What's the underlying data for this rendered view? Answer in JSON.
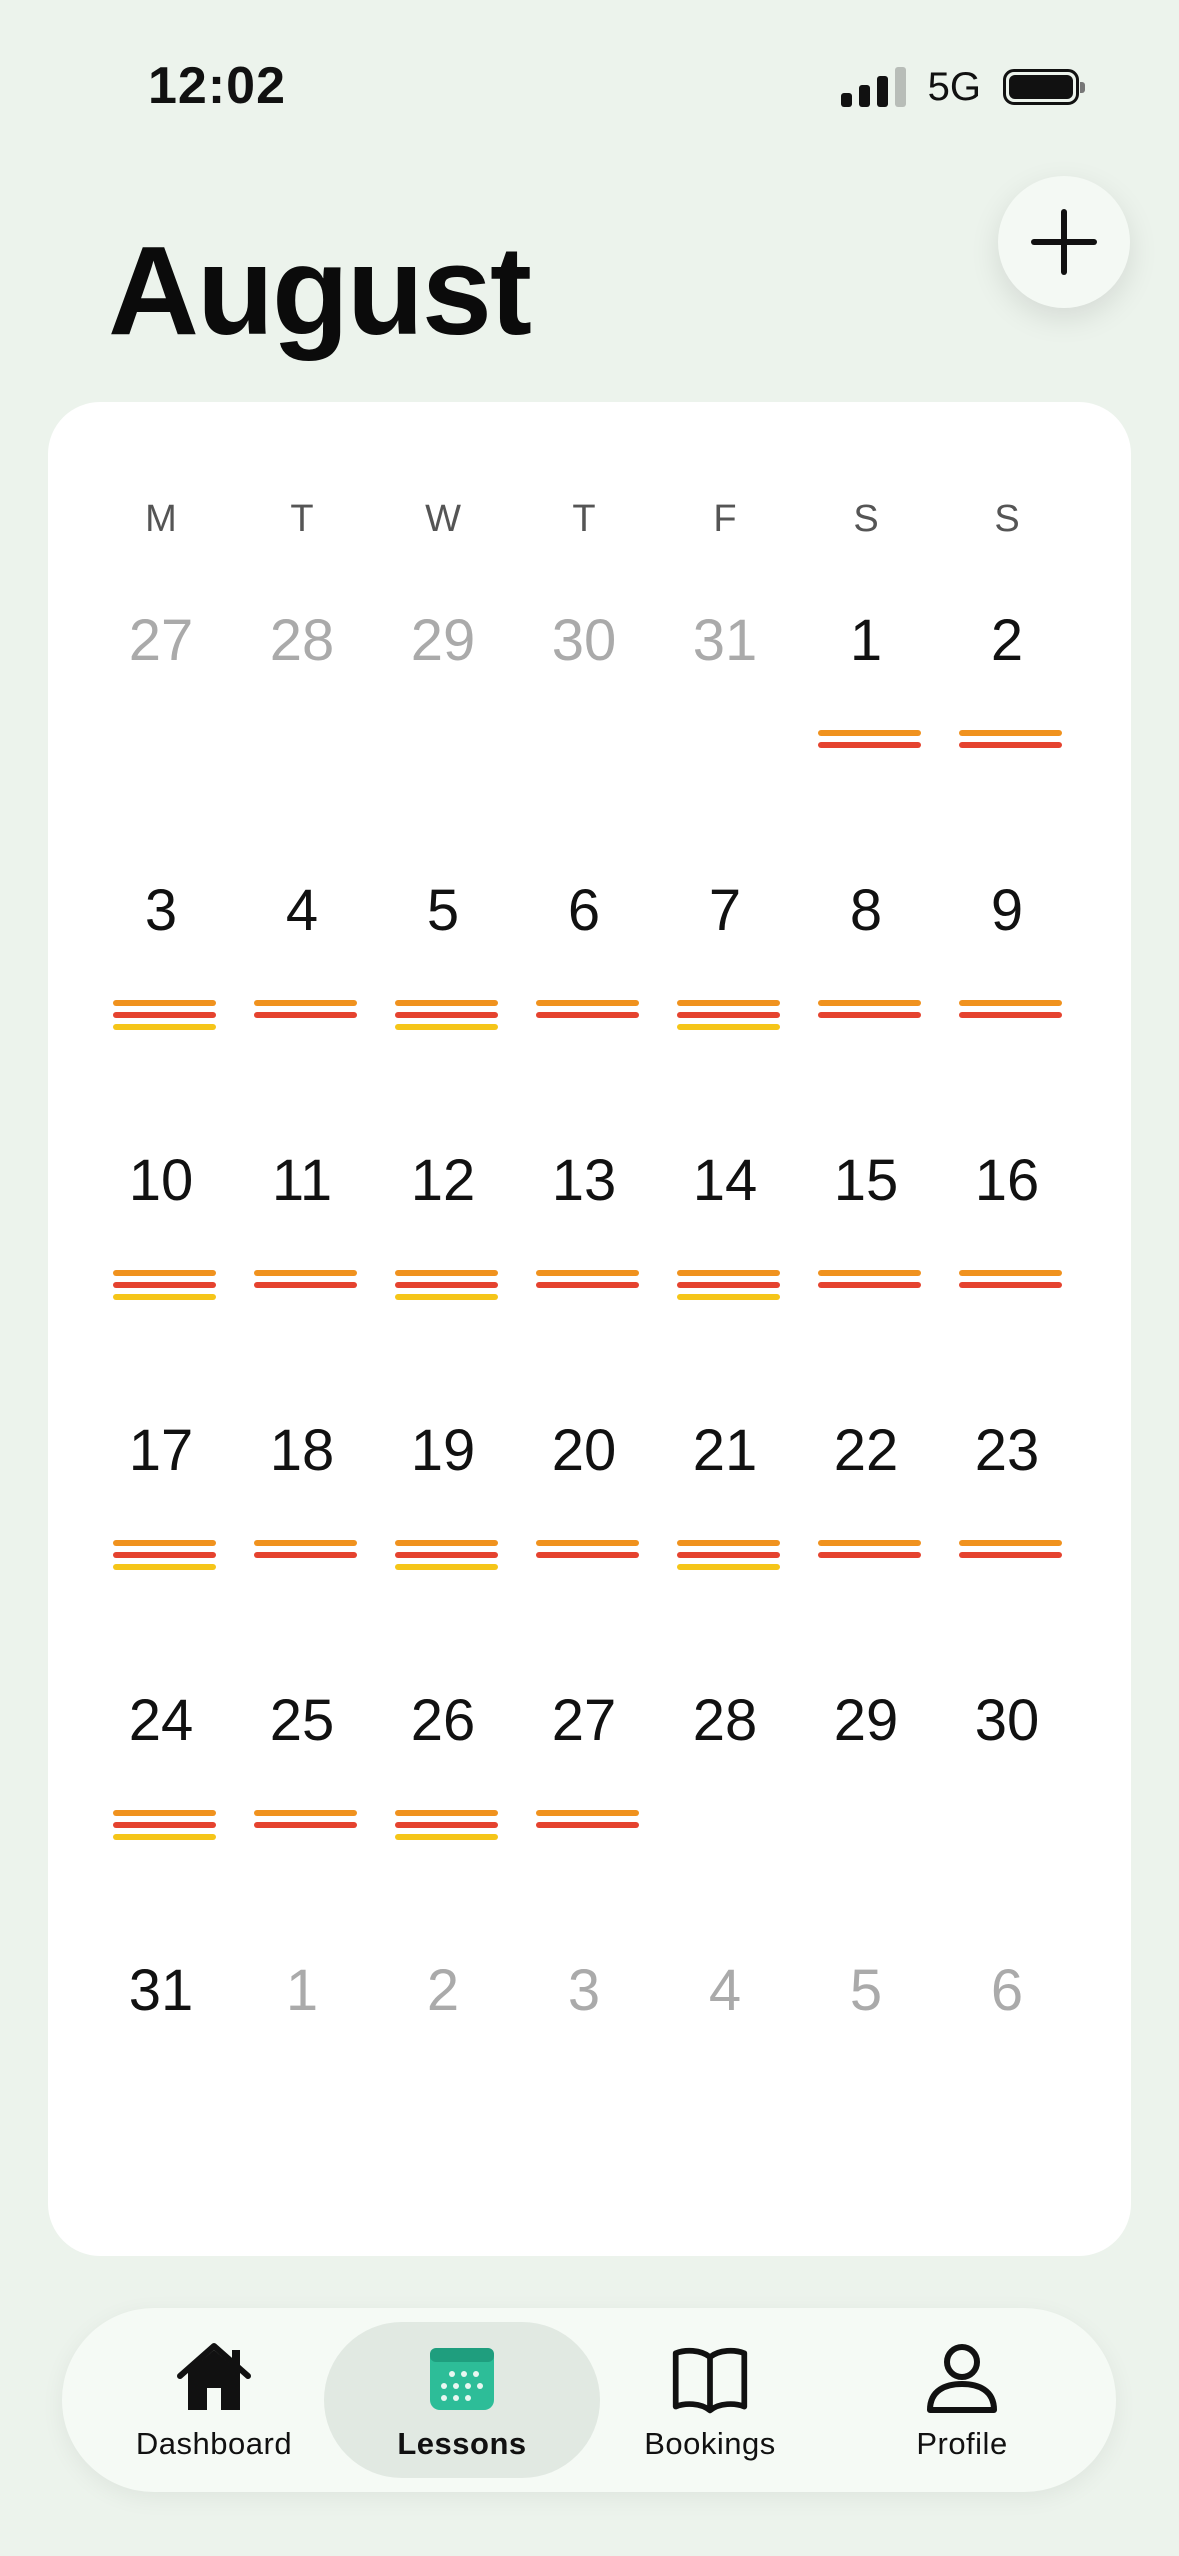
{
  "status": {
    "time": "12:02",
    "network": "5G"
  },
  "header": {
    "title": "August",
    "add_icon": "plus-icon"
  },
  "calendar": {
    "weekdays": [
      "M",
      "T",
      "W",
      "T",
      "F",
      "S",
      "S"
    ],
    "weeks": [
      [
        {
          "day": "27",
          "faded": true,
          "bars": []
        },
        {
          "day": "28",
          "faded": true,
          "bars": []
        },
        {
          "day": "29",
          "faded": true,
          "bars": []
        },
        {
          "day": "30",
          "faded": true,
          "bars": []
        },
        {
          "day": "31",
          "faded": true,
          "bars": []
        },
        {
          "day": "1",
          "faded": false,
          "bars": [
            "orange",
            "red"
          ]
        },
        {
          "day": "2",
          "faded": false,
          "bars": [
            "orange",
            "red"
          ]
        }
      ],
      [
        {
          "day": "3",
          "faded": false,
          "bars": [
            "orange",
            "red",
            "yellow"
          ]
        },
        {
          "day": "4",
          "faded": false,
          "bars": [
            "orange",
            "red"
          ]
        },
        {
          "day": "5",
          "faded": false,
          "bars": [
            "orange",
            "red",
            "yellow"
          ]
        },
        {
          "day": "6",
          "faded": false,
          "bars": [
            "orange",
            "red"
          ]
        },
        {
          "day": "7",
          "faded": false,
          "bars": [
            "orange",
            "red",
            "yellow"
          ]
        },
        {
          "day": "8",
          "faded": false,
          "bars": [
            "orange",
            "red"
          ]
        },
        {
          "day": "9",
          "faded": false,
          "bars": [
            "orange",
            "red"
          ]
        }
      ],
      [
        {
          "day": "10",
          "faded": false,
          "bars": [
            "orange",
            "red",
            "yellow"
          ]
        },
        {
          "day": "11",
          "faded": false,
          "bars": [
            "orange",
            "red"
          ]
        },
        {
          "day": "12",
          "faded": false,
          "bars": [
            "orange",
            "red",
            "yellow"
          ]
        },
        {
          "day": "13",
          "faded": false,
          "bars": [
            "orange",
            "red"
          ]
        },
        {
          "day": "14",
          "faded": false,
          "bars": [
            "orange",
            "red",
            "yellow"
          ]
        },
        {
          "day": "15",
          "faded": false,
          "bars": [
            "orange",
            "red"
          ]
        },
        {
          "day": "16",
          "faded": false,
          "bars": [
            "orange",
            "red"
          ]
        }
      ],
      [
        {
          "day": "17",
          "faded": false,
          "bars": [
            "orange",
            "red",
            "yellow"
          ]
        },
        {
          "day": "18",
          "faded": false,
          "bars": [
            "orange",
            "red"
          ]
        },
        {
          "day": "19",
          "faded": false,
          "bars": [
            "orange",
            "red",
            "yellow"
          ]
        },
        {
          "day": "20",
          "faded": false,
          "bars": [
            "orange",
            "red"
          ]
        },
        {
          "day": "21",
          "faded": false,
          "bars": [
            "orange",
            "red",
            "yellow"
          ]
        },
        {
          "day": "22",
          "faded": false,
          "bars": [
            "orange",
            "red"
          ]
        },
        {
          "day": "23",
          "faded": false,
          "bars": [
            "orange",
            "red"
          ]
        }
      ],
      [
        {
          "day": "24",
          "faded": false,
          "bars": [
            "orange",
            "red",
            "yellow"
          ]
        },
        {
          "day": "25",
          "faded": false,
          "bars": [
            "orange",
            "red"
          ]
        },
        {
          "day": "26",
          "faded": false,
          "bars": [
            "orange",
            "red",
            "yellow"
          ]
        },
        {
          "day": "27",
          "faded": false,
          "bars": [
            "orange",
            "red"
          ]
        },
        {
          "day": "28",
          "faded": false,
          "bars": []
        },
        {
          "day": "29",
          "faded": false,
          "bars": []
        },
        {
          "day": "30",
          "faded": false,
          "bars": []
        }
      ],
      [
        {
          "day": "31",
          "faded": false,
          "bars": []
        },
        {
          "day": "1",
          "faded": true,
          "bars": []
        },
        {
          "day": "2",
          "faded": true,
          "bars": []
        },
        {
          "day": "3",
          "faded": true,
          "bars": []
        },
        {
          "day": "4",
          "faded": true,
          "bars": []
        },
        {
          "day": "5",
          "faded": true,
          "bars": []
        },
        {
          "day": "6",
          "faded": true,
          "bars": []
        }
      ]
    ],
    "colors": {
      "orange": "#f0921e",
      "red": "#e5432f",
      "yellow": "#f5c518",
      "faded_text": "#aaaaaa"
    }
  },
  "tabs": [
    {
      "label": "Dashboard",
      "icon": "home-icon",
      "active": false
    },
    {
      "label": "Lessons",
      "icon": "calendar-icon",
      "active": true
    },
    {
      "label": "Bookings",
      "icon": "book-icon",
      "active": false
    },
    {
      "label": "Profile",
      "icon": "person-icon",
      "active": false
    }
  ],
  "accent": "#2dbd98"
}
